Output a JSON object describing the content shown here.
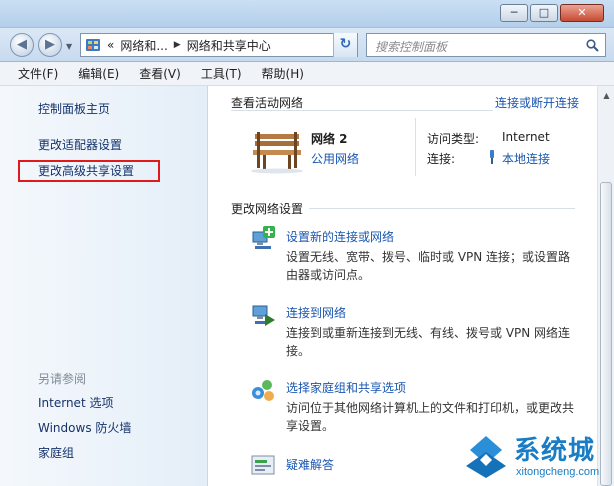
{
  "window": {
    "minimize_glyph": "─",
    "maximize_glyph": "□",
    "close_glyph": "✕"
  },
  "nav": {
    "back_glyph": "◀",
    "forward_glyph": "▶",
    "breadcrumb": {
      "overflow": "«",
      "segment1": "网络和...",
      "separator": "▶",
      "segment2": "网络和共享中心",
      "dropdown": "▼"
    },
    "refresh_glyph": "↻",
    "search_placeholder": "搜索控制面板"
  },
  "menu": [
    "文件(F)",
    "编辑(E)",
    "查看(V)",
    "工具(T)",
    "帮助(H)"
  ],
  "sidebar": {
    "items": [
      "控制面板主页",
      "更改适配器设置",
      "更改高级共享设置"
    ],
    "see_also_label": "另请参阅",
    "see_also": [
      "Internet 选项",
      "Windows 防火墙",
      "家庭组"
    ]
  },
  "active_networks": {
    "heading": "查看活动网络",
    "connect_link": "连接或断开连接",
    "network_name": "网络  2",
    "network_type": "公用网络",
    "access_type_label": "访问类型:",
    "access_type_value": "Internet",
    "connection_label": "连接:",
    "connection_value": "本地连接"
  },
  "change_settings": {
    "heading": "更改网络设置",
    "tasks": [
      {
        "title": "设置新的连接或网络",
        "desc1": "设置无线、宽带、拨号、临时或 VPN 连接；或设置路",
        "desc2": "由器或访问点。",
        "icon": "network-setup-icon"
      },
      {
        "title": "连接到网络",
        "desc1": "连接到或重新连接到无线、有线、拨号或 VPN 网络连",
        "desc2": "接。",
        "icon": "connect-network-icon"
      },
      {
        "title": "选择家庭组和共享选项",
        "desc1": "访问位于其他网络计算机上的文件和打印机，或更改共",
        "desc2": "享设置。",
        "icon": "homegroup-icon"
      },
      {
        "title": "疑难解答",
        "desc1": "",
        "desc2": "",
        "icon": "troubleshoot-icon"
      }
    ]
  },
  "watermark": {
    "title": "系统城",
    "url": "xitongcheng.com"
  },
  "colors": {
    "link": "#1a56b0",
    "highlight_box": "#e01a1a",
    "watermark": "#1a7cc4"
  }
}
